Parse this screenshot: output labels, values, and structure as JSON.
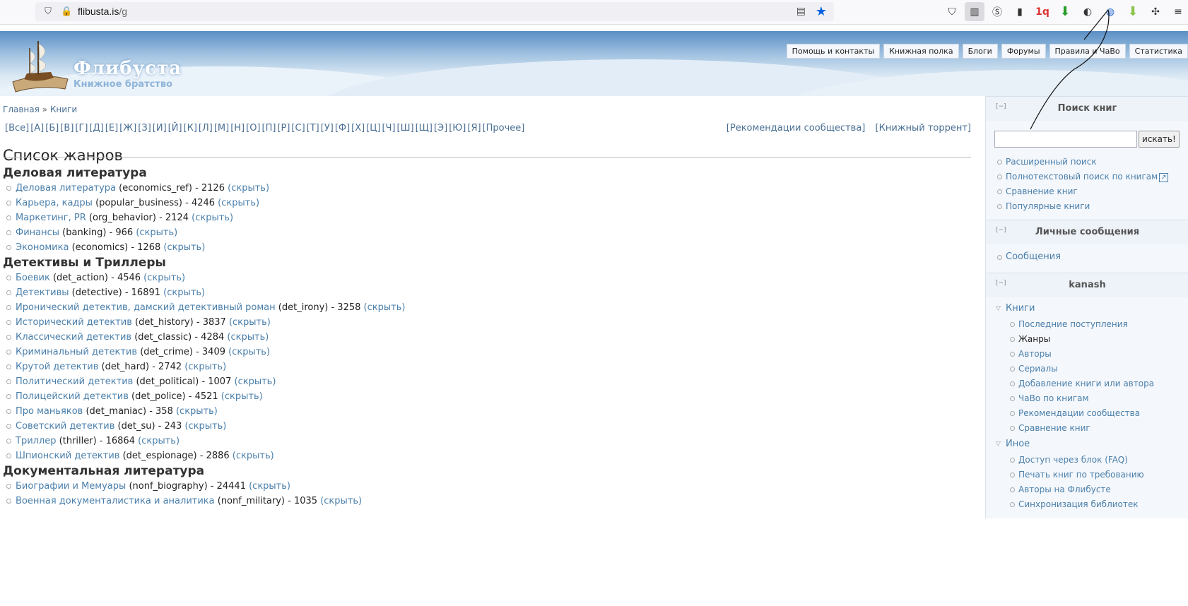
{
  "browser": {
    "url_host": "flibusta.is",
    "url_path": "/g",
    "icons": [
      "shield-icon",
      "permissions-icon",
      "reader-view-icon",
      "bookmark-star-icon",
      "pocket-icon",
      "sidebar-icon",
      "extension-s-icon",
      "extension-icon",
      "1q-icon",
      "download-arrow-icon",
      "extension-icon",
      "globe-extension-icon",
      "download-arrow-icon",
      "puzzle-icon",
      "menu-icon"
    ]
  },
  "header": {
    "logo_title": "Флибуста",
    "logo_subtitle": "Книжное братство",
    "nav": [
      "Помощь и контакты",
      "Книжная полка",
      "Блоги",
      "Форумы",
      "Правила и ЧаВо",
      "Статистика"
    ]
  },
  "breadcrumb": {
    "home": "Главная",
    "sep": "»",
    "current": "Книги"
  },
  "letters": [
    "[Все]",
    "[А]",
    "[Б]",
    "[В]",
    "[Г]",
    "[Д]",
    "[Е]",
    "[Ж]",
    "[З]",
    "[И]",
    "[Й]",
    "[К]",
    "[Л]",
    "[М]",
    "[Н]",
    "[О]",
    "[П]",
    "[Р]",
    "[С]",
    "[Т]",
    "[У]",
    "[Ф]",
    "[Х]",
    "[Ц]",
    "[Ч]",
    "[Ш]",
    "[Щ]",
    "[Э]",
    "[Ю]",
    "[Я]",
    "[Прочее]"
  ],
  "extra_links": [
    "[Рекомендации сообщества]",
    "[Книжный торрент]"
  ],
  "page_title": "Список жанров",
  "hide_label": "(скрыть)",
  "groups": [
    {
      "title": "Деловая литература",
      "genres": [
        {
          "name": "Деловая литература",
          "code": "(economics_ref) - 2126"
        },
        {
          "name": "Карьера, кадры",
          "code": "(popular_business) - 4246"
        },
        {
          "name": "Маркетинг, PR",
          "code": "(org_behavior) - 2124"
        },
        {
          "name": "Финансы",
          "code": "(banking) - 966"
        },
        {
          "name": "Экономика",
          "code": "(economics) - 1268"
        }
      ]
    },
    {
      "title": "Детективы и Триллеры",
      "genres": [
        {
          "name": "Боевик",
          "code": "(det_action) - 4546"
        },
        {
          "name": "Детективы",
          "code": "(detective) - 16891"
        },
        {
          "name": "Иронический детектив, дамский детективный роман",
          "code": "(det_irony) - 3258"
        },
        {
          "name": "Исторический детектив",
          "code": "(det_history) - 3837"
        },
        {
          "name": "Классический детектив",
          "code": "(det_classic) - 4284"
        },
        {
          "name": "Криминальный детектив",
          "code": "(det_crime) - 3409"
        },
        {
          "name": "Крутой детектив",
          "code": "(det_hard) - 2742"
        },
        {
          "name": "Политический детектив",
          "code": "(det_political) - 1007"
        },
        {
          "name": "Полицейский детектив",
          "code": "(det_police) - 4521"
        },
        {
          "name": "Про маньяков",
          "code": "(det_maniac) - 358"
        },
        {
          "name": "Советский детектив",
          "code": "(det_su) - 243"
        },
        {
          "name": "Триллер",
          "code": "(thriller) - 16864"
        },
        {
          "name": "Шпионский детектив",
          "code": "(det_espionage) - 2886"
        }
      ]
    },
    {
      "title": "Документальная литература",
      "genres": [
        {
          "name": "Биографии и Мемуары",
          "code": "(nonf_biography) - 24441"
        },
        {
          "name": "Военная документалистика и аналитика",
          "code": "(nonf_military) - 1035"
        }
      ]
    }
  ],
  "sidebar": {
    "toggle": "[−]",
    "search": {
      "title": "Поиск книг",
      "button": "искать!",
      "links": [
        "Расширенный поиск",
        "Полнотекстовый поиск по книгам",
        "Сравнение книг",
        "Популярные книги"
      ]
    },
    "messages": {
      "title": "Личные сообщения",
      "links": [
        "Сообщения"
      ]
    },
    "user": {
      "title": "kanash",
      "books_label": "Книги",
      "books_items": [
        "Последние поступления",
        "Жанры",
        "Авторы",
        "Сериалы",
        "Добавление книги или автора",
        "ЧаВо по книгам",
        "Рекомендации сообщества",
        "Сравнение книг"
      ],
      "other_label": "Иное",
      "other_items": [
        "Доступ через блок (FAQ)",
        "Печать книг по требованию",
        "Авторы на Флибусте",
        "Синхронизация библиотек"
      ]
    }
  }
}
